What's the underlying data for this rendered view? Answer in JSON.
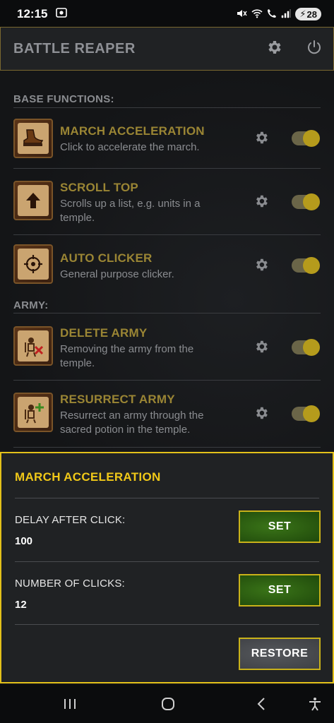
{
  "status_bar": {
    "time": "12:15",
    "battery": "28"
  },
  "header": {
    "title": "BATTLE REAPER",
    "settings_icon": "gear-icon",
    "power_icon": "power-icon"
  },
  "sections": {
    "base_label": "BASE FUNCTIONS:",
    "army_label": "ARMY:"
  },
  "functions": [
    {
      "title": "MARCH ACCELERATION",
      "desc_line1": "Click to accelerate the march.",
      "desc_line2": "",
      "icon": "boot-icon",
      "enabled": true
    },
    {
      "title": "SCROLL TOP",
      "desc_line1": "Scrolls up a list, e.g. units in a",
      "desc_line2": "temple.",
      "icon": "arrow-up-icon",
      "enabled": true
    },
    {
      "title": "AUTO CLICKER",
      "desc_line1": "General purpose clicker.",
      "desc_line2": "",
      "icon": "crosshair-icon",
      "enabled": true
    },
    {
      "title": "DELETE ARMY",
      "desc_line1": "Removing the army from the",
      "desc_line2": "temple.",
      "icon": "skeleton-delete-icon",
      "enabled": true
    },
    {
      "title": "RESURRECT ARMY",
      "desc_line1": "Resurrect an army through the",
      "desc_line2": "sacred potion in the temple.",
      "icon": "skeleton-plus-icon",
      "enabled": true
    }
  ],
  "panel": {
    "title": "MARCH ACCELERATION",
    "delay_label": "DELAY AFTER CLICK:",
    "delay_value": "100",
    "clicks_label": "NUMBER OF CLICKS:",
    "clicks_value": "12",
    "set_label": "SET",
    "restore_label": "RESTORE"
  },
  "colors": {
    "accent_yellow": "#e3c11a",
    "title_gold": "#9a8534",
    "set_green": "#2a5a10"
  }
}
